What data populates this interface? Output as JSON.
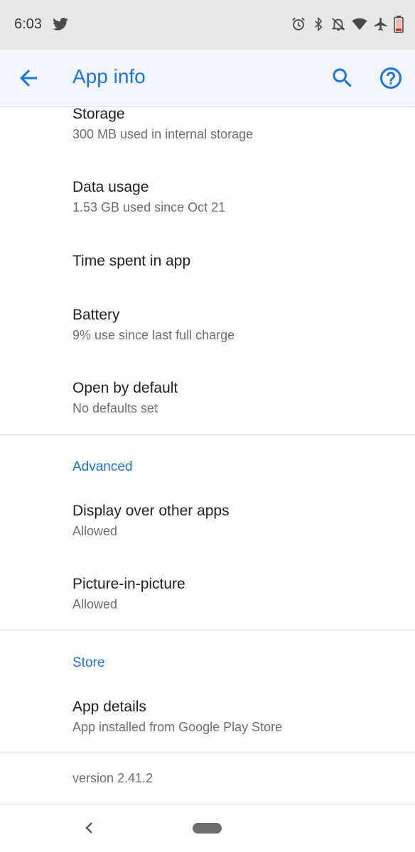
{
  "status_bar": {
    "time": "6:03",
    "icons": [
      "twitter-icon",
      "alarm-icon",
      "bluetooth-icon",
      "notifications-off-icon",
      "wifi-icon",
      "airplane-icon",
      "battery-low-icon"
    ]
  },
  "app_bar": {
    "title": "App info",
    "accent_color": "#1a73e8"
  },
  "items": {
    "storage": {
      "title": "Storage",
      "summary": "300 MB used in internal storage"
    },
    "data_usage": {
      "title": "Data usage",
      "summary": "1.53 GB used since Oct 21"
    },
    "time_spent": {
      "title": "Time spent in app"
    },
    "battery": {
      "title": "Battery",
      "summary": "9% use since last full charge"
    },
    "open_by_default": {
      "title": "Open by default",
      "summary": "No defaults set"
    },
    "display_over": {
      "title": "Display over other apps",
      "summary": "Allowed"
    },
    "pip": {
      "title": "Picture-in-picture",
      "summary": "Allowed"
    },
    "app_details": {
      "title": "App details",
      "summary": "App installed from Google Play Store"
    }
  },
  "sections": {
    "advanced": "Advanced",
    "store": "Store"
  },
  "version": "version 2.41.2"
}
